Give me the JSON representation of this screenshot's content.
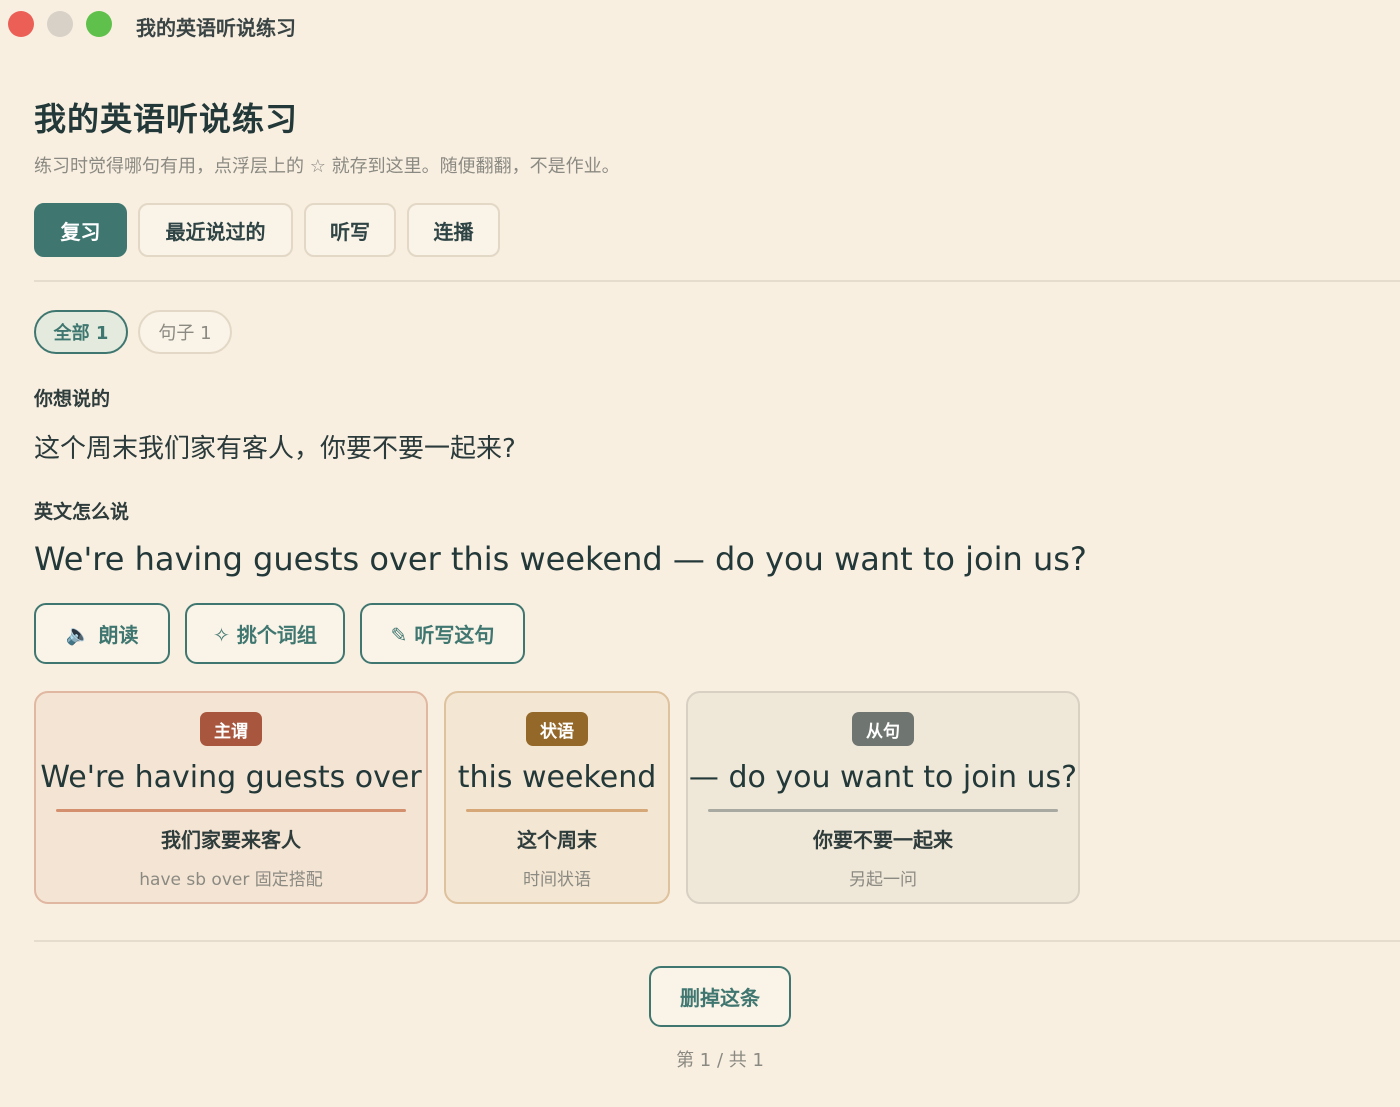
{
  "window": {
    "title": "我的英语听说练习"
  },
  "header": {
    "title": "我的英语听说练习",
    "subtitle": "练习时觉得哪句有用，点浮层上的 ☆ 就存到这里。随便翻翻，不是作业。"
  },
  "tabs": [
    {
      "label": "复习",
      "active": true
    },
    {
      "label": "最近说过的",
      "active": false
    },
    {
      "label": "听写",
      "active": false
    },
    {
      "label": "连播",
      "active": false
    }
  ],
  "filters": [
    {
      "label": "全部 1",
      "active": true
    },
    {
      "label": "句子 1",
      "active": false
    }
  ],
  "entry": {
    "cn_label": "你想说的",
    "cn_sentence": "这个周末我们家有客人，你要不要一起来?",
    "en_label": "英文怎么说",
    "en_sentence": "We're having guests over this weekend — do you want to join us?"
  },
  "actions": {
    "read_icon": "🔈",
    "read_label": "朗读",
    "phrase_label": "✧ 挑个词组",
    "dictate_label": "✎ 听写这句"
  },
  "chunks": [
    {
      "tag": "主谓",
      "phrase": "We're having guests over",
      "meaning": "我们家要来客人",
      "note": "have sb over 固定搭配"
    },
    {
      "tag": "状语",
      "phrase": "this weekend",
      "meaning": "这个周末",
      "note": "时间状语"
    },
    {
      "tag": "从句",
      "phrase": "— do you want to join us?",
      "meaning": "你要不要一起来",
      "note": "另起一问"
    }
  ],
  "footer": {
    "delete_label": "删掉这条",
    "pager": "第 1 / 共 1"
  },
  "colors": {
    "accent": "#3f7770",
    "background": "#f8efe1",
    "subject_tag": "#a8573e",
    "adverb_tag": "#946829",
    "clause_tag": "#6f7570"
  }
}
